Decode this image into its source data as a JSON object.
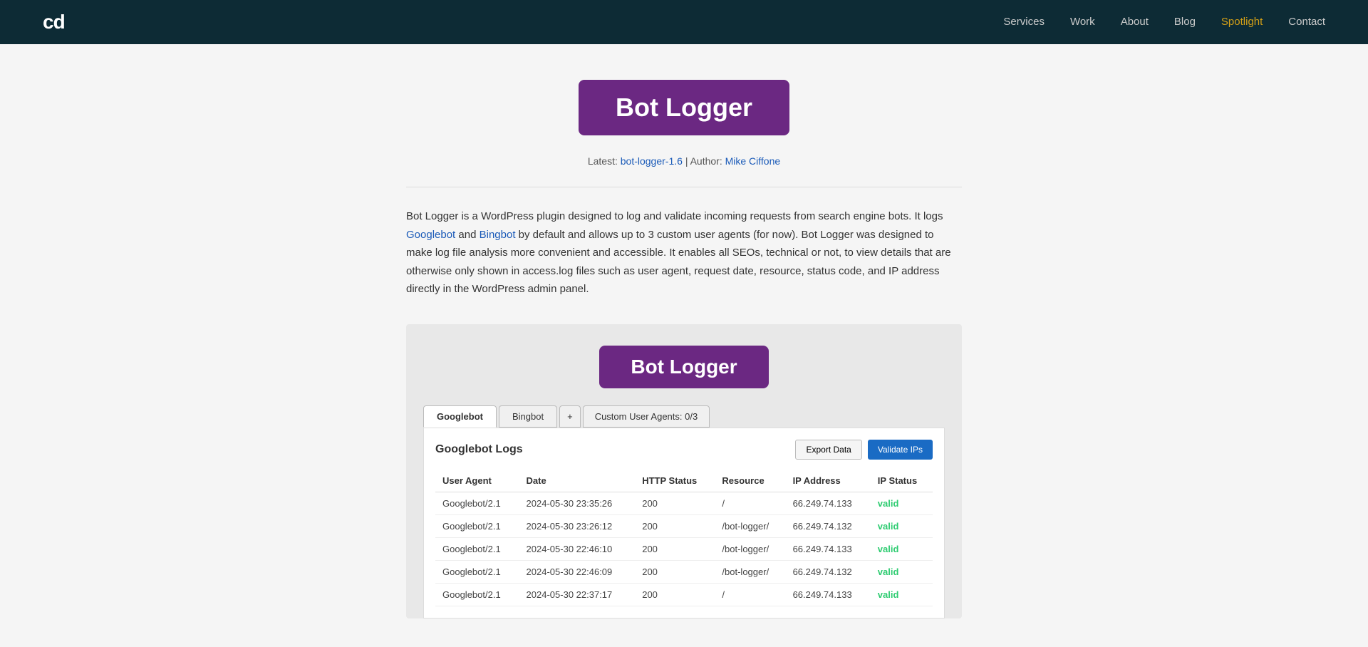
{
  "nav": {
    "logo": "cd",
    "links": [
      {
        "label": "Services",
        "href": "#",
        "active": false
      },
      {
        "label": "Work",
        "href": "#",
        "active": false
      },
      {
        "label": "About",
        "href": "#",
        "active": false
      },
      {
        "label": "Blog",
        "href": "#",
        "active": false
      },
      {
        "label": "Spotlight",
        "href": "#",
        "active": true
      },
      {
        "label": "Contact",
        "href": "#",
        "active": false
      }
    ]
  },
  "hero": {
    "title": "Bot Logger"
  },
  "meta": {
    "latest_label": "Latest:",
    "latest_link_text": "bot-logger-1.6",
    "separator": "|",
    "author_label": "Author:",
    "author_link_text": "Mike Ciffone"
  },
  "description": {
    "text_parts": [
      "Bot Logger is a WordPress plugin designed to log and validate incoming requests from search engine bots. It logs ",
      " and ",
      " by default and allows up to 3 custom user agents (for now). Bot Logger was designed to make log file analysis more convenient and accessible. It enables all SEOs, technical or not, to view details that are otherwise only shown in access.log files such as user agent, request date, resource, status code, and IP address directly in the WordPress admin panel."
    ],
    "link1_text": "Googlebot",
    "link2_text": "Bingbot"
  },
  "screenshot": {
    "inner_title": "Bot Logger",
    "tabs": [
      {
        "label": "Googlebot",
        "active": true
      },
      {
        "label": "Bingbot",
        "active": false
      },
      {
        "label": "+",
        "type": "plus"
      },
      {
        "label": "Custom User Agents: 0/3",
        "active": false
      }
    ],
    "table_title": "Googlebot Logs",
    "btn_export": "Export Data",
    "btn_validate": "Validate IPs",
    "columns": [
      "User Agent",
      "Date",
      "HTTP Status",
      "Resource",
      "IP Address",
      "IP Status"
    ],
    "rows": [
      {
        "user_agent": "Googlebot/2.1",
        "date": "2024-05-30 23:35:26",
        "http_status": "200",
        "resource": "/",
        "ip_address": "66.249.74.133",
        "ip_status": "valid"
      },
      {
        "user_agent": "Googlebot/2.1",
        "date": "2024-05-30 23:26:12",
        "http_status": "200",
        "resource": "/bot-logger/",
        "ip_address": "66.249.74.132",
        "ip_status": "valid"
      },
      {
        "user_agent": "Googlebot/2.1",
        "date": "2024-05-30 22:46:10",
        "http_status": "200",
        "resource": "/bot-logger/",
        "ip_address": "66.249.74.133",
        "ip_status": "valid"
      },
      {
        "user_agent": "Googlebot/2.1",
        "date": "2024-05-30 22:46:09",
        "http_status": "200",
        "resource": "/bot-logger/",
        "ip_address": "66.249.74.132",
        "ip_status": "valid"
      },
      {
        "user_agent": "Googlebot/2.1",
        "date": "2024-05-30 22:37:17",
        "http_status": "200",
        "resource": "/",
        "ip_address": "66.249.74.133",
        "ip_status": "valid"
      }
    ]
  }
}
